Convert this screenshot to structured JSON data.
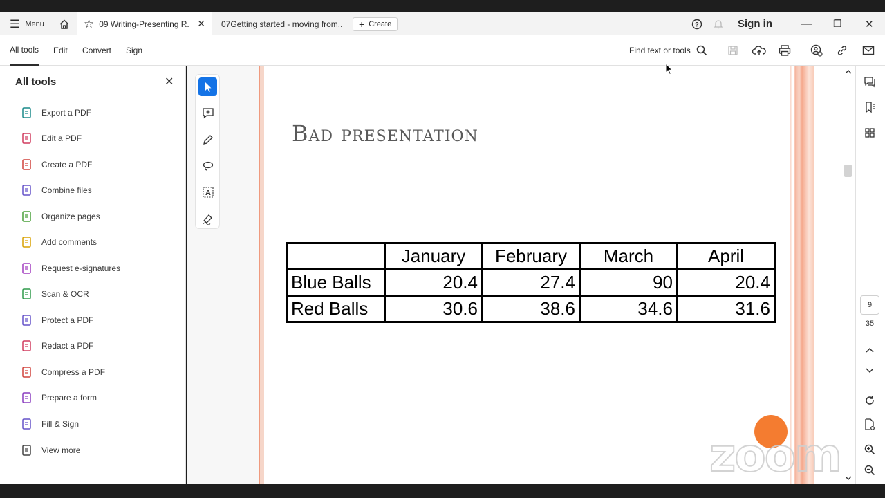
{
  "titlebar": {
    "menu_label": "Menu",
    "tabs": [
      {
        "label": "09 Writing-Presenting R..."
      },
      {
        "label": "07Getting started - moving from..."
      }
    ],
    "create_label": "Create",
    "sign_in_label": "Sign in"
  },
  "toolbar": {
    "tabs": [
      "All tools",
      "Edit",
      "Convert",
      "Sign"
    ],
    "find_label": "Find text or tools"
  },
  "sidebar": {
    "title": "All tools",
    "items": [
      {
        "label": "Export a PDF",
        "icon": "export-pdf-icon",
        "color": "#1a8a8a"
      },
      {
        "label": "Edit a PDF",
        "icon": "edit-pdf-icon",
        "color": "#d03b5f"
      },
      {
        "label": "Create a PDF",
        "icon": "create-pdf-icon",
        "color": "#d0423b"
      },
      {
        "label": "Combine files",
        "icon": "combine-files-icon",
        "color": "#6552c9"
      },
      {
        "label": "Organize pages",
        "icon": "organize-pages-icon",
        "color": "#4aa03a"
      },
      {
        "label": "Add comments",
        "icon": "add-comments-icon",
        "color": "#d9a100"
      },
      {
        "label": "Request e-signatures",
        "icon": "request-esign-icon",
        "color": "#a23dbf"
      },
      {
        "label": "Scan & OCR",
        "icon": "scan-ocr-icon",
        "color": "#2f9a4a"
      },
      {
        "label": "Protect a PDF",
        "icon": "protect-pdf-icon",
        "color": "#6552c9"
      },
      {
        "label": "Redact a PDF",
        "icon": "redact-pdf-icon",
        "color": "#d03b5f"
      },
      {
        "label": "Compress a PDF",
        "icon": "compress-pdf-icon",
        "color": "#d0423b"
      },
      {
        "label": "Prepare a form",
        "icon": "prepare-form-icon",
        "color": "#8a3dbf"
      },
      {
        "label": "Fill & Sign",
        "icon": "fill-sign-icon",
        "color": "#6552c9"
      },
      {
        "label": "View more",
        "icon": "wrench-icon",
        "color": "#444444"
      }
    ]
  },
  "document": {
    "slide_title": "Bad presentation",
    "table": {
      "headers": [
        "",
        "January",
        "February",
        "March",
        "April"
      ],
      "rows": [
        [
          "Blue Balls",
          "20.4",
          "27.4",
          "90",
          "20.4"
        ],
        [
          "Red Balls",
          "30.6",
          "38.6",
          "34.6",
          "31.6"
        ]
      ]
    }
  },
  "pagination": {
    "current": "9",
    "total": "35"
  },
  "watermark": {
    "text": "zoom"
  },
  "colors": {
    "accent": "#1473e6",
    "zoom_orange": "#f47c30"
  }
}
